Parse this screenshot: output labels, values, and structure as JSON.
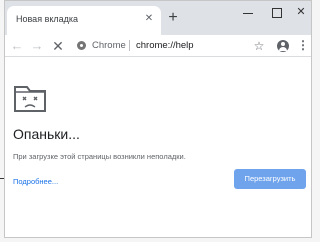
{
  "window": {
    "tab_title": "Новая вкладка",
    "tab_close_glyph": "✕",
    "new_tab_glyph": "+",
    "controls": {
      "minimize_icon": "minimize-icon",
      "maximize_icon": "maximize-icon",
      "close_icon": "close-icon",
      "close_glyph": "✕"
    }
  },
  "toolbar": {
    "back_glyph": "←",
    "forward_glyph": "→",
    "stop_glyph": "✕",
    "site_label": "Chrome",
    "url": "chrome://help",
    "star_glyph": "☆",
    "menu_glyph": "⋮"
  },
  "page": {
    "title": "Опаньки...",
    "message": "При загрузке этой страницы возникли неполадки.",
    "learn_more": "Подробнее...",
    "reload_button": "Перезагрузить"
  },
  "colors": {
    "accent_button": "#6fa4ec",
    "link": "#1a73e8",
    "titlebar": "#dee1e6"
  }
}
